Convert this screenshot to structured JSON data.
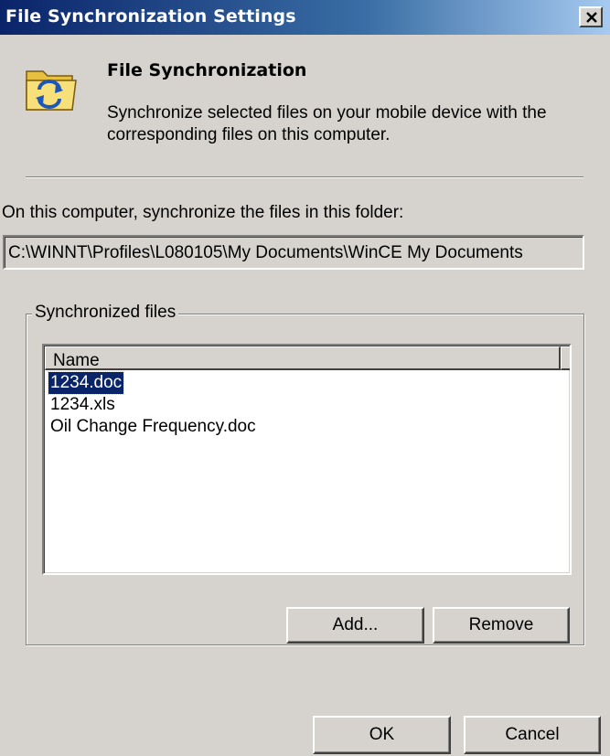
{
  "window": {
    "title": "File Synchronization Settings",
    "close_icon": "close-icon"
  },
  "header": {
    "icon": "folder-sync-icon",
    "title": "File Synchronization",
    "description": "Synchronize selected files on your mobile device with the corresponding files on this computer."
  },
  "folder": {
    "label": "On this computer, synchronize the files in this folder:",
    "path": "C:\\WINNT\\Profiles\\L080105\\My Documents\\WinCE My Documents"
  },
  "synchronized_files": {
    "group_label": "Synchronized files",
    "column_name": "Name",
    "items": [
      {
        "name": "1234.doc",
        "selected": true
      },
      {
        "name": "1234.xls",
        "selected": false
      },
      {
        "name": "Oil Change Frequency.doc",
        "selected": false
      }
    ],
    "add_label": "Add...",
    "remove_label": "Remove"
  },
  "footer": {
    "ok_label": "OK",
    "cancel_label": "Cancel"
  },
  "colors": {
    "titlebar_start": "#0a246a",
    "titlebar_end": "#a6caf0",
    "face": "#d6d3ce",
    "selection": "#0a246a"
  }
}
